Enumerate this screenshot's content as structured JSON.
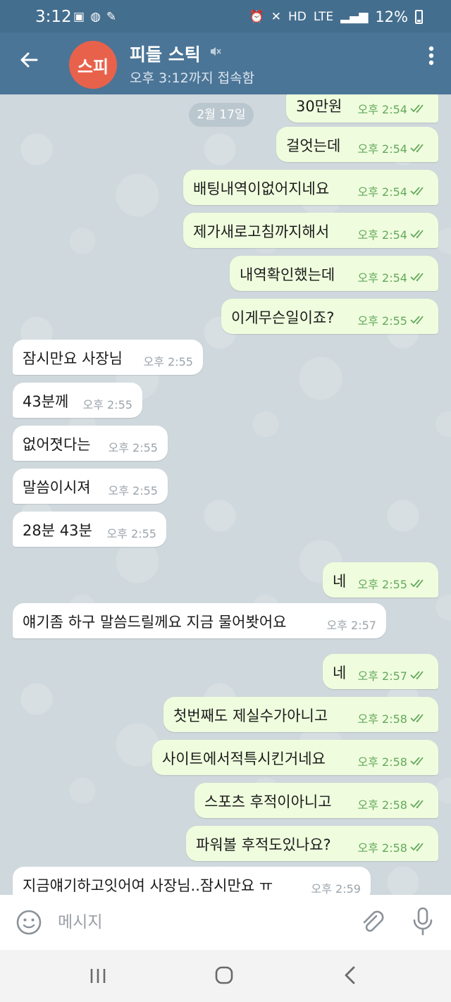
{
  "status_bar": {
    "time": "3:12",
    "battery": "12%",
    "network": "LTE",
    "icons": [
      "gallery-icon",
      "talk-icon",
      "wrench-icon",
      "alarm-icon",
      "mute-icon",
      "hd-voice-icon",
      "signal-icon",
      "battery-icon"
    ]
  },
  "header": {
    "avatar_initials": "스피",
    "avatar_color": "#e8624b",
    "title": "피들 스틱",
    "subtitle": "오후 3:12까지 접속함",
    "bar_color": "#4b7597"
  },
  "date_chip": "2월 17일",
  "messages": [
    {
      "dir": "out",
      "text": "30만원",
      "time": "오후 2:54"
    },
    {
      "dir": "out",
      "text": "걸엇는데",
      "time": "오후 2:54"
    },
    {
      "dir": "out",
      "text": "배팅내역이없어지네요",
      "time": "오후 2:54"
    },
    {
      "dir": "out",
      "text": "제가새로고침까지해서",
      "time": "오후 2:54"
    },
    {
      "dir": "out",
      "text": "내역확인했는데",
      "time": "오후 2:54"
    },
    {
      "dir": "out",
      "text": "이게무슨일이죠?",
      "time": "오후 2:55"
    },
    {
      "dir": "in",
      "text": "잠시만요 사장님",
      "time": "오후 2:55"
    },
    {
      "dir": "in",
      "text": "43분께",
      "time": "오후 2:55"
    },
    {
      "dir": "in",
      "text": "없어졋다는",
      "time": "오후 2:55"
    },
    {
      "dir": "in",
      "text": "말씀이시져",
      "time": "오후 2:55"
    },
    {
      "dir": "in",
      "text": "28분 43분",
      "time": "오후 2:55"
    },
    {
      "dir": "out",
      "text": "네",
      "time": "오후 2:55"
    },
    {
      "dir": "in",
      "text": "얘기좀 하구 말씀드릴께요 지금 물어봣어요",
      "time": "오후 2:57"
    },
    {
      "dir": "out",
      "text": "네",
      "time": "오후 2:57"
    },
    {
      "dir": "out",
      "text": "첫번째도 제실수가아니고",
      "time": "오후 2:58"
    },
    {
      "dir": "out",
      "text": "사이트에서적특시킨거네요",
      "time": "오후 2:58"
    },
    {
      "dir": "out",
      "text": "스포츠 후적이아니고",
      "time": "오후 2:58"
    },
    {
      "dir": "out",
      "text": "파워볼 후적도있나요?",
      "time": "오후 2:58"
    },
    {
      "dir": "in",
      "text": "지금얘기하고잇어여 사장님..잠시만요 ㅠ",
      "time": "오후 2:59"
    }
  ],
  "composer": {
    "placeholder": "메시지"
  },
  "colors": {
    "outgoing_bubble": "#effdde",
    "incoming_bubble": "#ffffff",
    "outgoing_meta": "#64a85c",
    "chat_background": "#cfd8dc"
  }
}
